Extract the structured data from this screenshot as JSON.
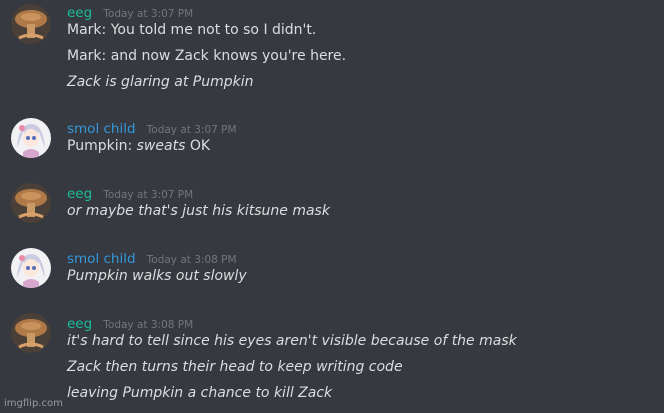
{
  "colors": {
    "background": "#36393f",
    "eeg_name": "#1abc9c",
    "smol_name": "#3498db",
    "message_text": "#dcddde",
    "timestamp": "#72767d"
  },
  "groups": [
    {
      "author": "eeg",
      "avatar_icon": "mushroom-avatar-icon",
      "timestamp": "Today at 3:07 PM",
      "messages": [
        {
          "text": "Mark: You told me not to so I didn't.",
          "italic": false
        },
        {
          "text": "Mark: and now Zack knows you're here.",
          "italic": false
        },
        {
          "text": "Zack is glaring at Pumpkin",
          "italic": true
        }
      ]
    },
    {
      "author": "smol child",
      "avatar_icon": "anime-girl-avatar-icon",
      "timestamp": "Today at 3:07 PM",
      "messages": [
        {
          "prefix": "Pumpkin: ",
          "emph": "sweats",
          "suffix": " OK"
        }
      ]
    },
    {
      "author": "eeg",
      "avatar_icon": "mushroom-avatar-icon",
      "timestamp": "Today at 3:07 PM",
      "messages": [
        {
          "text": "or maybe that's just his kitsune mask",
          "italic": true
        }
      ]
    },
    {
      "author": "smol child",
      "avatar_icon": "anime-girl-avatar-icon",
      "timestamp": "Today at 3:08 PM",
      "messages": [
        {
          "text": "Pumpkin walks out slowly",
          "italic": true
        }
      ]
    },
    {
      "author": "eeg",
      "avatar_icon": "mushroom-avatar-icon",
      "timestamp": "Today at 3:08 PM",
      "messages": [
        {
          "text": "it's hard to tell since his eyes aren't visible because of the mask",
          "italic": true
        },
        {
          "text": "Zack then turns their head to keep writing code",
          "italic": true
        },
        {
          "text": "leaving Pumpkin a chance to kill Zack",
          "italic": true
        }
      ]
    }
  ],
  "watermark": "imgflip.com"
}
